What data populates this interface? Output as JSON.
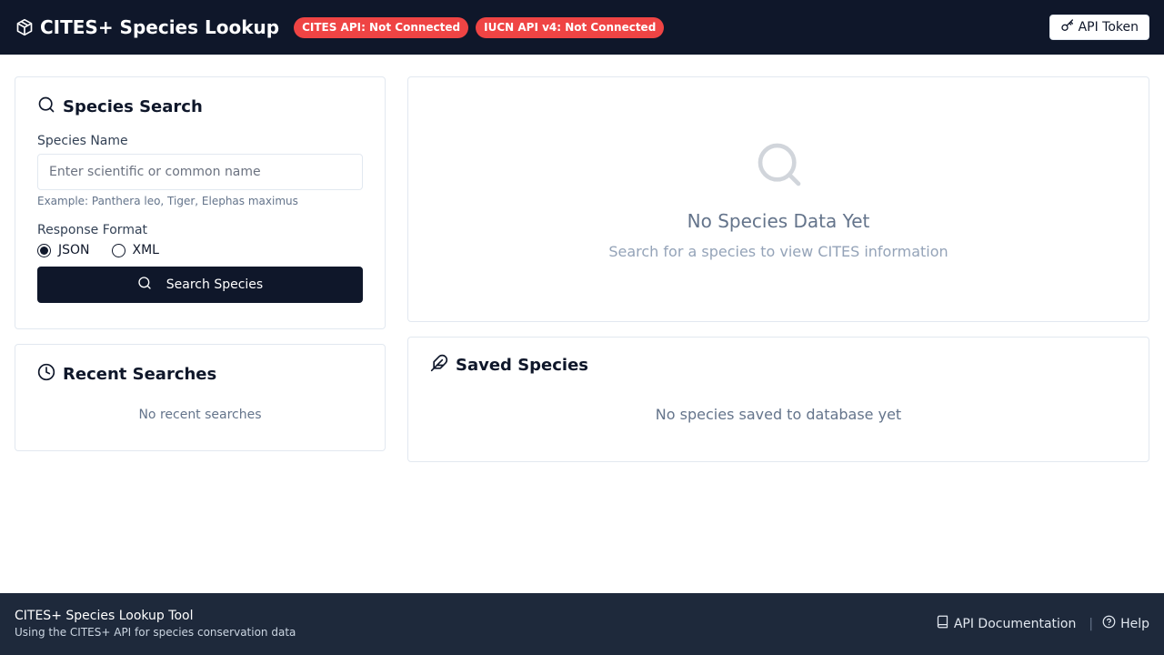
{
  "header": {
    "title": "CITES+ Species Lookup",
    "badges": [
      "CITES API: Not Connected",
      "IUCN API v4: Not Connected"
    ],
    "token_button": "API Token"
  },
  "search": {
    "title": "Species Search",
    "name_label": "Species Name",
    "placeholder": "Enter scientific or common name",
    "value": "",
    "hint": "Example: Panthera leo, Tiger, Elephas maximus",
    "format_label": "Response Format",
    "formats": [
      "JSON",
      "XML"
    ],
    "selected_format": "JSON",
    "button": "Search Species"
  },
  "recent": {
    "title": "Recent Searches",
    "empty": "No recent searches"
  },
  "results": {
    "empty_title": "No Species Data Yet",
    "empty_subtitle": "Search for a species to view CITES information"
  },
  "saved": {
    "title": "Saved Species",
    "empty": "No species saved to database yet"
  },
  "footer": {
    "title": "CITES+ Species Lookup Tool",
    "subtitle": "Using the CITES+ API for species conservation data",
    "links": [
      "API Documentation",
      "Help"
    ]
  },
  "colors": {
    "header_bg": "#0f172a",
    "footer_bg": "#1e293b",
    "badge_red": "#ef4444",
    "primary": "#0f172a"
  },
  "icons": {
    "logo": "hexagon-box-icon",
    "token": "key-icon",
    "search": "search-icon",
    "recent": "clock-icon",
    "saved": "feather-icon",
    "docs": "book-icon",
    "help": "help-circle-icon"
  }
}
